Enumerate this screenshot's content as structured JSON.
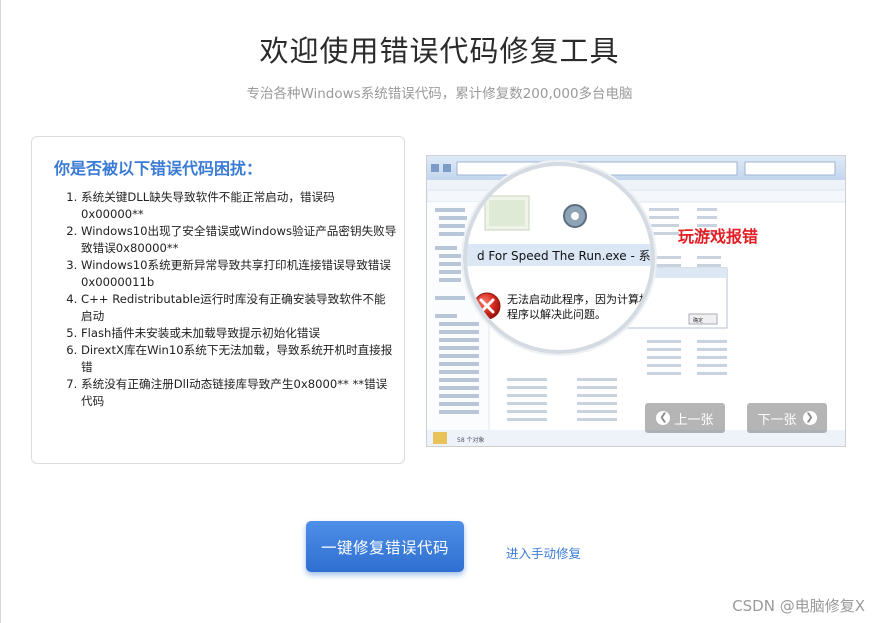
{
  "page": {
    "title": "欢迎使用错误代码修复工具",
    "subtitle": "专治各种Windows系统错误代码，累计修复数200,000多台电脑"
  },
  "card": {
    "title": "你是否被以下错误代码困扰：",
    "items": [
      "系统关键DLL缺失导致软件不能正常启动，错误码0x00000**",
      "Windows10出现了安全错误或Windows验证产品密钥失败导致错误0x80000**",
      "Windows10系统更新异常导致共享打印机连接错误导致错误0x0000011b",
      "C++ Redistributable运行时库没有正确安装导致软件不能启动",
      "Flash插件未安装或未加载导致提示初始化错误",
      "DirextX库在Win10系统下无法加载，导致系统开机时直接报错",
      "系统没有正确注册Dll动态链接库导致产生0x8000** **错误代码"
    ]
  },
  "screenshot": {
    "annotation": "玩游戏报错",
    "dialog_title": "d For Speed The Run.exe - 系统错误",
    "dialog_message_line1": "无法启动此程序，因为计算机中丢",
    "dialog_message_line2": "程序以解决此问题。",
    "dialog_ok": "确定",
    "status_count": "58 个对象",
    "prev_label": "上一张",
    "next_label": "下一张",
    "prev_icon": "chevron-left-icon",
    "next_icon": "chevron-right-icon"
  },
  "actions": {
    "fix_button": "一键修复错误代码",
    "manual_link": "进入手动修复"
  },
  "watermark": "CSDN @电脑修复X",
  "colors": {
    "accent": "#3a7bd5",
    "error_red": "#e31e24",
    "button_blue": "#2f6fd0"
  }
}
